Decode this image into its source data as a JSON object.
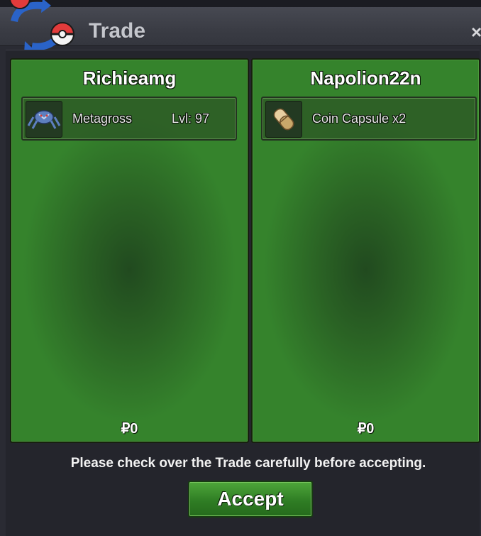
{
  "window": {
    "title": "Trade",
    "close_glyph": "×"
  },
  "icons": {
    "logo": "trade-pokeball-arrows-icon",
    "close": "close-icon",
    "metagross": "metagross-sprite-icon",
    "coin_capsule": "coin-capsule-icon"
  },
  "left_panel": {
    "player": "Richieamg",
    "items": [
      {
        "name": "Metagross",
        "detail": "Lvl: 97"
      }
    ],
    "money": "₽0"
  },
  "right_panel": {
    "player": "Napolion22n",
    "items": [
      {
        "name": "Coin Capsule  x2"
      }
    ],
    "money": "₽0"
  },
  "footer": {
    "notice": "Please check over the Trade carefully before accepting.",
    "accept_label": "Accept"
  },
  "colors": {
    "panel_green": "#35832c",
    "button_green": "#2f7d24",
    "window_dark": "#2a2b33"
  }
}
